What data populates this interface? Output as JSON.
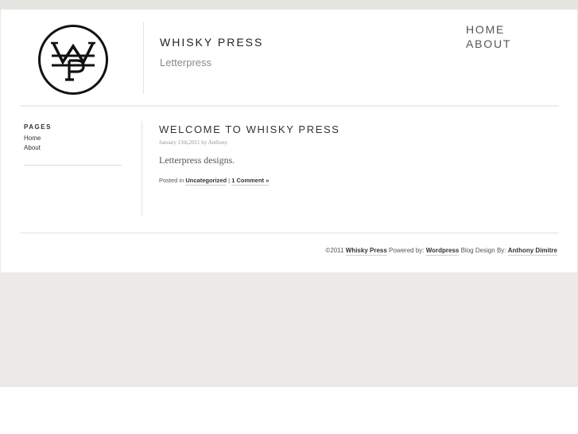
{
  "header": {
    "site_title": "WHISKY PRESS",
    "tagline": "Letterpress",
    "logo": {
      "icon": "wp-monogram-logo"
    }
  },
  "nav": {
    "items": [
      {
        "label": "HOME"
      },
      {
        "label": "ABOUT"
      }
    ]
  },
  "sidebar": {
    "heading": "PAGES",
    "links": [
      {
        "label": "Home"
      },
      {
        "label": "About"
      }
    ]
  },
  "post": {
    "title": "WELCOME TO WHISKY PRESS",
    "meta": "January 13th,2011 by Anthony",
    "body": "Letterpress designs.",
    "posted_in_label": "Posted in",
    "category": "Uncategorized",
    "separator": "|",
    "comments": "1 Comment »"
  },
  "footer": {
    "copyright": "©2011",
    "site_link": "Whisky Press",
    "powered_label": "Powered by:",
    "powered_link": "Wordpress",
    "design_label": "Blog Design By:",
    "designer_link": "Anthony Dimitre"
  },
  "colors": {
    "background": "#ebeae6",
    "card": "#ffffff",
    "text": "#333333",
    "muted": "#8a8a8a"
  }
}
